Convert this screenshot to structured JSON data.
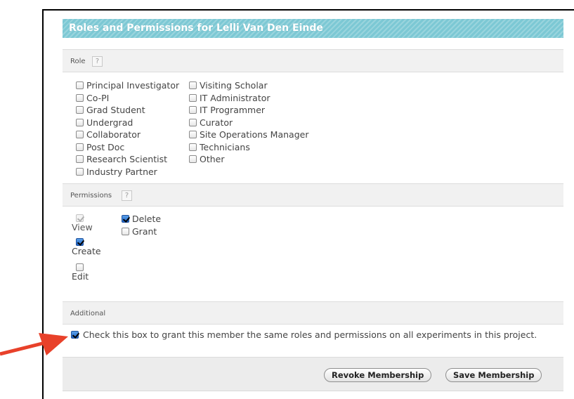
{
  "title": "Roles and Permissions for Lelli Van Den Einde",
  "role_section": {
    "label": "Role",
    "help": "?",
    "column1": [
      {
        "label": "Principal Investigator",
        "checked": false
      },
      {
        "label": "Co-PI",
        "checked": false
      },
      {
        "label": "Grad Student",
        "checked": false
      },
      {
        "label": "Undergrad",
        "checked": false
      },
      {
        "label": "Collaborator",
        "checked": false
      },
      {
        "label": "Post Doc",
        "checked": false
      },
      {
        "label": "Research Scientist",
        "checked": false
      },
      {
        "label": "Industry Partner",
        "checked": false
      }
    ],
    "column2": [
      {
        "label": "Visiting Scholar",
        "checked": false
      },
      {
        "label": "IT Administrator",
        "checked": false
      },
      {
        "label": "IT Programmer",
        "checked": false
      },
      {
        "label": "Curator",
        "checked": false
      },
      {
        "label": "Site Operations Manager",
        "checked": false
      },
      {
        "label": "Technicians",
        "checked": false
      },
      {
        "label": "Other",
        "checked": false
      }
    ]
  },
  "permissions_section": {
    "label": "Permissions",
    "help": "?",
    "view": {
      "label": "View",
      "checked": true,
      "disabled": true
    },
    "create": {
      "label": "Create",
      "checked": true
    },
    "edit": {
      "label": "Edit",
      "checked": false
    },
    "delete": {
      "label": "Delete",
      "checked": true
    },
    "grant": {
      "label": "Grant",
      "checked": false
    }
  },
  "additional_section": {
    "label": "Additional",
    "checkbox_checked": true,
    "text": "Check this box to grant this member the same roles and permissions on all experiments in this project."
  },
  "buttons": {
    "revoke": "Revoke Membership",
    "save": "Save Membership"
  },
  "colors": {
    "title_bar": "#7cc8d4",
    "arrow": "#e8412a",
    "checkbox_checked": "#2a6fd0"
  }
}
